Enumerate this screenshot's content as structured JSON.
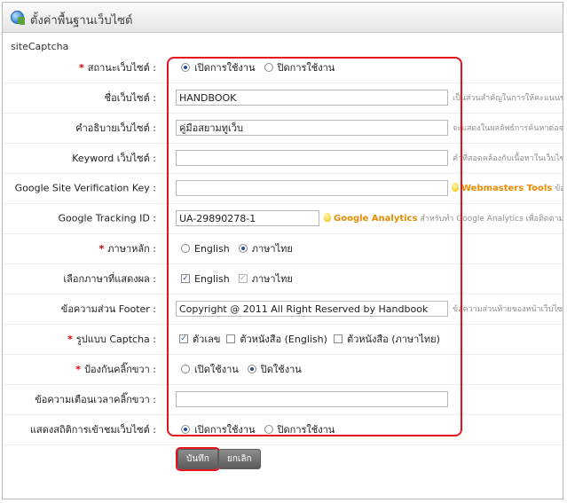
{
  "window": {
    "title": "ตั้งค่าพื้นฐานเว็บไซต์"
  },
  "section": {
    "label": "siteCaptcha"
  },
  "fields": {
    "site_status": {
      "label": "สถานะเว็บไซต์ :",
      "opt_on": "เปิดการใช้งาน",
      "opt_off": "ปิดการใช้งาน",
      "selected": "on"
    },
    "site_name": {
      "label": "ชื่อเว็บไซต์ :",
      "value": "HANDBOOK",
      "hint": "เป็นส่วนสำคัญในการให้คะแนนของ Google"
    },
    "site_desc": {
      "label": "คำอธิบายเว็บไซต์ :",
      "value": "คู่มือสยามทูเว็บ",
      "hint": "จะแสดงในผลลัพธ์การค้นหาต่อจาก Title"
    },
    "keyword": {
      "label": "Keyword เว็บไซต์ :",
      "value": "",
      "hint": "คำที่สอดคล้องกับเนื้อหาในเว็บไซต์"
    },
    "google_verify": {
      "label": "Google Site Verification Key :",
      "value": "",
      "link": "Webmasters Tools",
      "hint": "ข้อความ"
    },
    "google_tracking": {
      "label": "Google Tracking ID :",
      "value": "UA-29890278-1",
      "link": "Google Analytics",
      "hint": "สำหรับทำ Google Analytics เพื่อติดตามจำนวนผู้เข้าชม"
    },
    "main_language": {
      "label": "ภาษาหลัก :",
      "opt_en": "English",
      "opt_th": "ภาษาไทย",
      "selected": "th"
    },
    "display_languages": {
      "label": "เลือกภาษาที่แสดงผล :",
      "opt_en": "English",
      "opt_th": "ภาษาไทย"
    },
    "footer_text": {
      "label": "ข้อความส่วน Footer :",
      "value": "Copyright @ 2011 All Right Reserved by Handbook",
      "hint": "ข้อความส่วนท้ายของหน้าเว็บไซต์"
    },
    "captcha": {
      "label": "รูปแบบ Captcha :",
      "opt_num": "ตัวเลข",
      "opt_en": "ตัวหนังสือ (English)",
      "opt_th": "ตัวหนังสือ (ภาษาไทย)"
    },
    "right_click": {
      "label": "ป้องกันคลิ๊กขวา :",
      "opt_on": "เปิดใช้งาน",
      "opt_off": "ปิดใช้งาน",
      "selected": "off"
    },
    "right_click_msg": {
      "label": "ข้อความเตือนเวลาคลิ๊กขวา :",
      "value": ""
    },
    "visitor_stats": {
      "label": "แสดงสถิติการเข้าชมเว็บไซต์ :",
      "opt_on": "เปิดการใช้งาน",
      "opt_off": "ปิดการใช้งาน",
      "selected": "on"
    }
  },
  "buttons": {
    "save": "บันทึก",
    "cancel": "ยกเลิก"
  },
  "colors": {
    "highlight": "#e8141c",
    "required": "#dd0000",
    "link": "#e98b00"
  }
}
